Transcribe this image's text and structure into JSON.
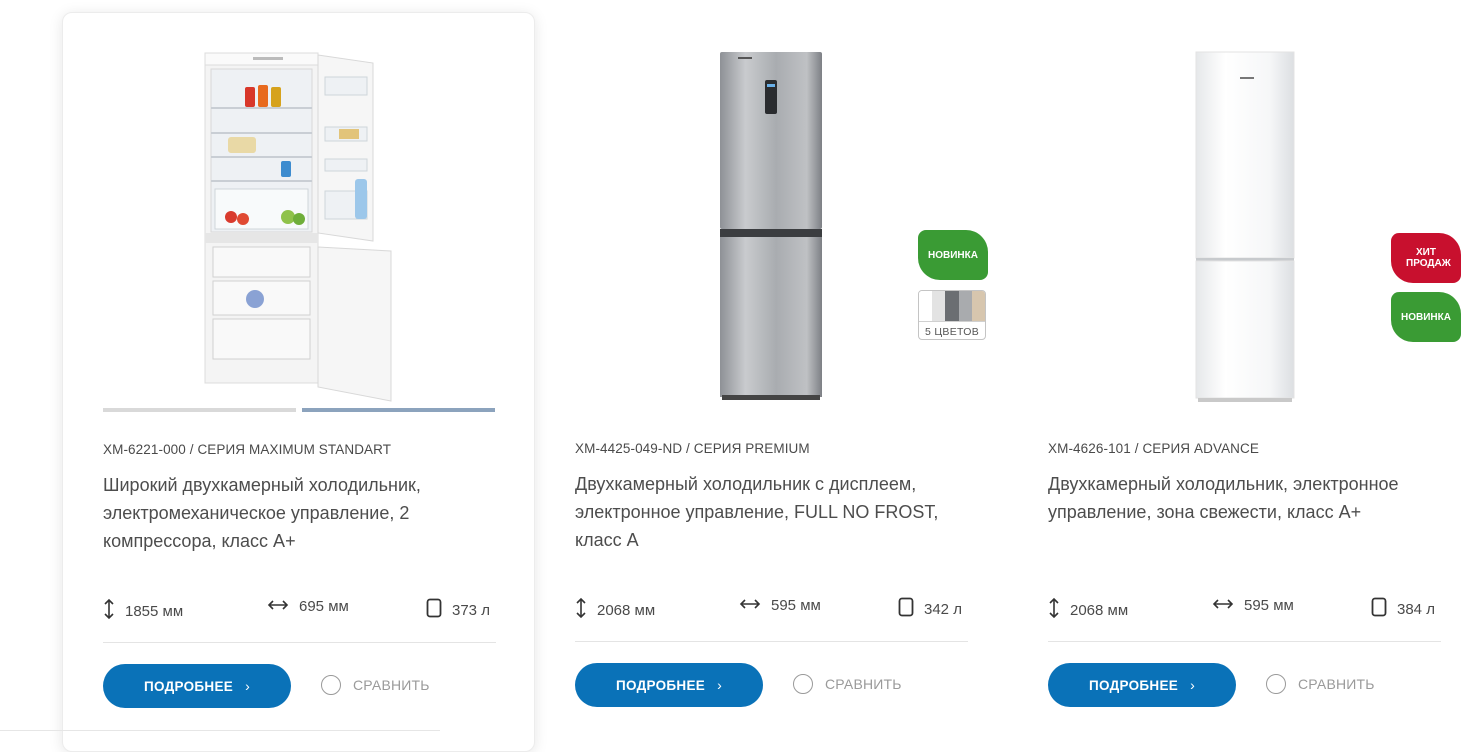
{
  "products": [
    {
      "code": "ХМ-6221-000 / СЕРИЯ MAXIMUM STANDART",
      "description": "Широкий двухкамерный холодильник, электромеханическое управление, 2 компрессора, класс А+",
      "height": "1855 мм",
      "width": "695 мм",
      "volume": "373 л",
      "details_label": "ПОДРОБНЕЕ",
      "compare_label": "СРАВНИТЬ",
      "image": "fridge-open-white"
    },
    {
      "code": "ХМ-4425-049-ND / СЕРИЯ PREMIUM",
      "description": "Двухкамерный холодильник с дисплеем, электронное управление, FULL NO FROST, класс А",
      "height": "2068 мм",
      "width": "595 мм",
      "volume": "342 л",
      "details_label": "ПОДРОБНЕЕ",
      "compare_label": "СРАВНИТЬ",
      "badges": [
        "НОВИНКА"
      ],
      "colors_label": "5 ЦВЕТОВ",
      "image": "fridge-steel"
    },
    {
      "code": "ХМ-4626-101 / СЕРИЯ ADVANCE",
      "description": "Двухкамерный холодильник, электронное управление, зона свежести, класс А+",
      "height": "2068 мм",
      "width": "595 мм",
      "volume": "384 л",
      "details_label": "ПОДРОБНЕЕ",
      "compare_label": "СРАВНИТЬ",
      "badges": [
        "ХИТ ПРОДАЖ",
        "НОВИНКА"
      ],
      "image": "fridge-white"
    }
  ],
  "colors": {
    "primary_button": "#0a72b8",
    "badge_new": "#3a9b34",
    "badge_hit": "#c8102e",
    "slider_active": "#8ca3bd"
  }
}
